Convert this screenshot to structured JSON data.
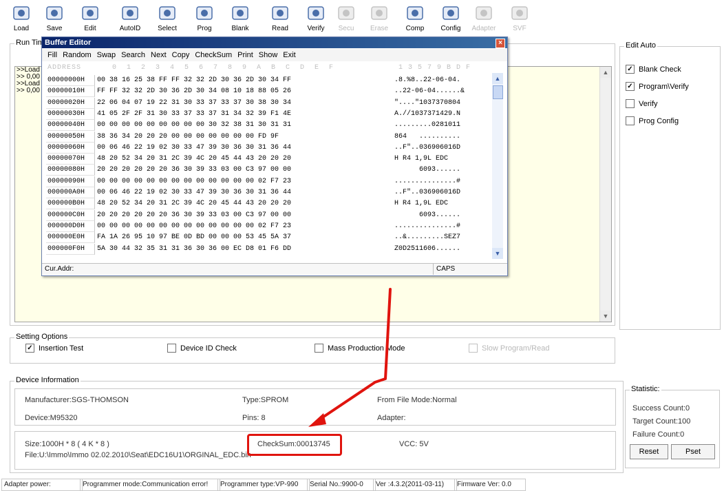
{
  "toolbar": {
    "buttons": [
      {
        "label": "Load",
        "icon": "folder-open-icon",
        "enabled": true
      },
      {
        "label": "Save",
        "icon": "floppy-disk-icon",
        "enabled": true
      },
      {
        "label": "Edit",
        "icon": "edit-document-icon",
        "enabled": true
      },
      {
        "label": "AutoID",
        "icon": "chip-id-icon",
        "enabled": true
      },
      {
        "label": "Select",
        "icon": "chip-select-icon",
        "enabled": true
      },
      {
        "label": "Prog",
        "icon": "program-chip-icon",
        "enabled": true
      },
      {
        "label": "Blank",
        "icon": "blank-check-icon",
        "enabled": true
      },
      {
        "label": "Read",
        "icon": "read-chip-icon",
        "enabled": true
      },
      {
        "label": "Verify",
        "icon": "verify-magnifier-icon",
        "enabled": true
      },
      {
        "label": "Secu",
        "icon": "lock-icon",
        "enabled": false
      },
      {
        "label": "Erase",
        "icon": "eraser-icon",
        "enabled": false
      },
      {
        "label": "Comp",
        "icon": "compare-icon",
        "enabled": true
      },
      {
        "label": "Config",
        "icon": "config-icon",
        "enabled": true
      },
      {
        "label": "Adapter",
        "icon": "adapter-icon",
        "enabled": false
      },
      {
        "label": "SVF",
        "icon": "svf-chip-icon",
        "enabled": false
      }
    ]
  },
  "runtime": {
    "title": "Run Tim",
    "lines": [
      ">>Load",
      ">> 0,00",
      ">>Load",
      ">> 0,00"
    ]
  },
  "edit_auto": {
    "title": "Edit Auto",
    "items": [
      {
        "label": "Blank Check",
        "checked": true
      },
      {
        "label": "Program\\Verify",
        "checked": true
      },
      {
        "label": "Verify",
        "checked": false
      },
      {
        "label": "Prog Config",
        "checked": false
      }
    ]
  },
  "settings": {
    "title": "Setting Options",
    "items": [
      {
        "label": "Insertion Test",
        "checked": true,
        "enabled": true
      },
      {
        "label": "Device ID Check",
        "checked": false,
        "enabled": true
      },
      {
        "label": "Mass Production Mode",
        "checked": false,
        "enabled": true
      },
      {
        "label": "Slow Program/Read",
        "checked": false,
        "enabled": false
      }
    ]
  },
  "device": {
    "title": "Device Information",
    "manufacturer": "Manufacturer:SGS-THOMSON",
    "type": "Type:SPROM",
    "file_mode": "From File Mode:Normal",
    "device": "Device:M95320",
    "pins": "Pins: 8",
    "adapter": "Adapter:",
    "size": "Size:1000H * 8 ( 4 K * 8 )",
    "checksum": "CheckSum:00013745",
    "vcc": "VCC: 5V",
    "file": "File:U:\\Immo\\Immo 02.02.2010\\Seat\\EDC16U1\\ORGINAL_EDC.bin"
  },
  "statistic": {
    "title": "Statistic:",
    "success": "Success Count:0",
    "target": "Target Count:100",
    "failure": "Failure Count:0",
    "reset": "Reset",
    "pset": "Pset"
  },
  "statusbar": {
    "adapter": "Adapter power:",
    "mode": "Programmer mode:Communication error!",
    "type": "Programmer type:VP-990",
    "serial": "Serial No.:9900-0",
    "ver": "Ver :4.3.2(2011-03-11)",
    "firmware": "Firmware Ver: 0.0"
  },
  "buffer_editor": {
    "title": "Buffer Editor",
    "menu": [
      "Fill",
      "Random",
      "Swap",
      "Search",
      "Next",
      "Copy",
      "CheckSum",
      "Print",
      "Show",
      "Exit"
    ],
    "header_address": "ADDRESS",
    "header_hex": "0  1  2  3  4  5  6  7  8  9  A  B  C  D  E  F",
    "header_ascii": "1 3 5 7 9 B D F",
    "rows": [
      {
        "addr": "00000000H",
        "hex": "00 38 16 25 38 FF FF 32 32 2D 30 36 2D 30 34 FF",
        "ascii": ".8.%8..22-06-04."
      },
      {
        "addr": "00000010H",
        "hex": "FF FF 32 32 2D 30 36 2D 30 34 08 10 18 88 05 26",
        "ascii": "..22-06-04......&"
      },
      {
        "addr": "00000020H",
        "hex": "22 06 04 07 19 22 31 30 33 37 33 37 30 38 30 34",
        "ascii": "\"....\"1037370804"
      },
      {
        "addr": "00000030H",
        "hex": "41 05 2F 2F 31 30 33 37 33 37 31 34 32 39 F1 4E",
        "ascii": "A.//1037371429.N"
      },
      {
        "addr": "00000040H",
        "hex": "00 00 00 00 00 00 00 00 00 30 32 38 31 30 31 31",
        "ascii": ".........0281011"
      },
      {
        "addr": "00000050H",
        "hex": "38 36 34 20 20 20 00 00 00 00 00 00 00 FD 9F",
        "ascii": "864   .........."
      },
      {
        "addr": "00000060H",
        "hex": "00 06 46 22 19 02 30 33 47 39 30 36 30 31 36 44",
        "ascii": "..F\"..036906016D"
      },
      {
        "addr": "00000070H",
        "hex": "48 20 52 34 20 31 2C 39 4C 20 45 44 43 20 20 20",
        "ascii": "H R4 1,9L EDC"
      },
      {
        "addr": "00000080H",
        "hex": "20 20 20 20 20 20 36 30 39 33 03 00 C3 97 00 00",
        "ascii": "      6093......"
      },
      {
        "addr": "00000090H",
        "hex": "00 00 00 00 00 00 00 00 00 00 00 00 00 02 F7 23",
        "ascii": "...............#"
      },
      {
        "addr": "000000A0H",
        "hex": "00 06 46 22 19 02 30 33 47 39 30 36 30 31 36 44",
        "ascii": "..F\"..036906016D"
      },
      {
        "addr": "000000B0H",
        "hex": "48 20 52 34 20 31 2C 39 4C 20 45 44 43 20 20 20",
        "ascii": "H R4 1,9L EDC"
      },
      {
        "addr": "000000C0H",
        "hex": "20 20 20 20 20 20 36 30 39 33 03 00 C3 97 00 00",
        "ascii": "      6093......"
      },
      {
        "addr": "000000D0H",
        "hex": "00 00 00 00 00 00 00 00 00 00 00 00 00 02 F7 23",
        "ascii": "...............#"
      },
      {
        "addr": "000000E0H",
        "hex": "FA 1A 26 95 10 97 BE 0D BD 00 00 00 53 45 5A 37",
        "ascii": "..&.........SEZ7"
      },
      {
        "addr": "000000F0H",
        "hex": "5A 30 44 32 35 31 31 36 30 36 00 EC D8 01 F6 DD",
        "ascii": "Z0D2511606......"
      }
    ],
    "status_addr": "Cur.Addr:",
    "status_caps": "CAPS"
  },
  "colors": {
    "annotation": "#e0140e",
    "title_bar_start": "#0a246a",
    "title_bar_end": "#3a6ea5",
    "log_background": "#ffffe8"
  }
}
